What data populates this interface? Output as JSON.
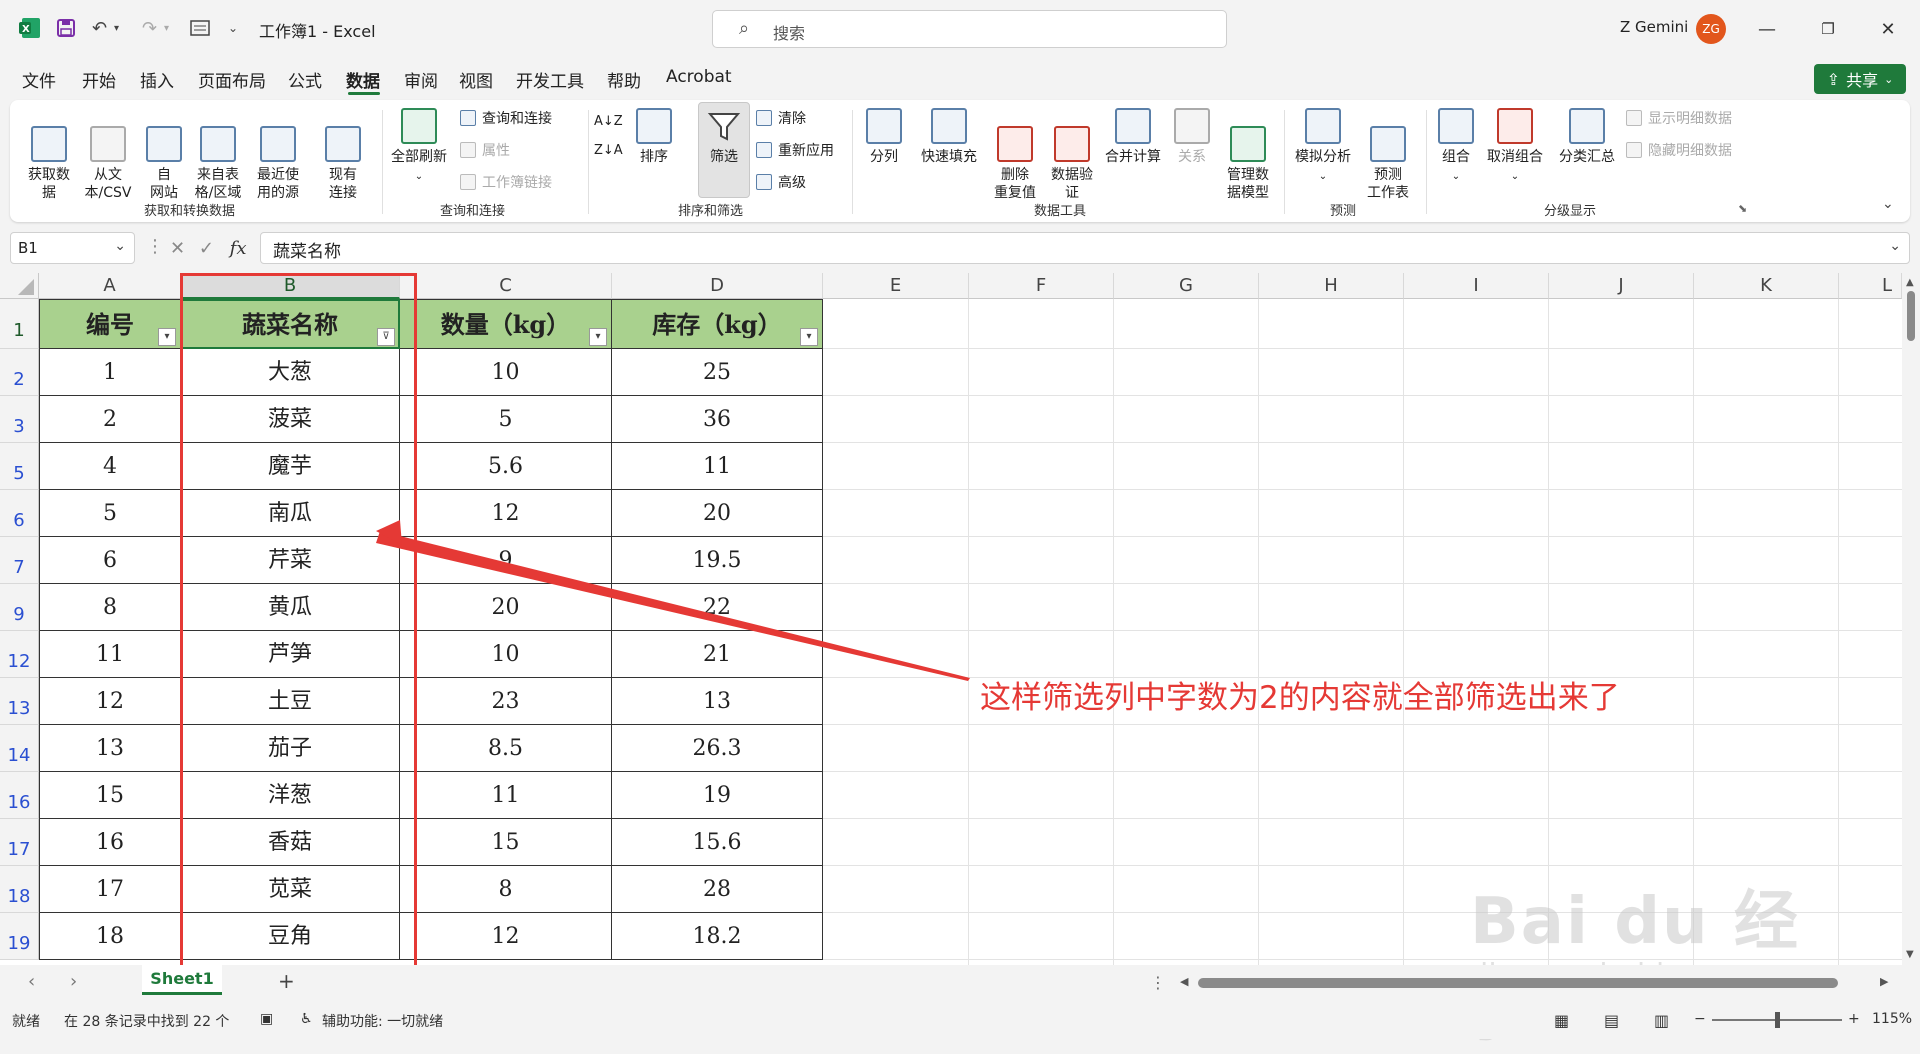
{
  "titlebar": {
    "title": "工作簿1 - Excel",
    "search_placeholder": "搜索",
    "user_name": "Z Gemini",
    "avatar_initials": "ZG"
  },
  "menu": {
    "tabs": [
      "文件",
      "开始",
      "插入",
      "页面布局",
      "公式",
      "数据",
      "审阅",
      "视图",
      "开发工具",
      "帮助",
      "Acrobat"
    ],
    "active_tab": "数据",
    "share_label": "共享"
  },
  "ribbon": {
    "get_data": "获取数\n据",
    "from_text_csv": "从文\n本/CSV",
    "from_web": "自\n网站",
    "from_table": "来自表\n格/区域",
    "recent_sources": "最近使\n用的源",
    "existing_connections": "现有\n连接",
    "group_get_transform": "获取和转换数据",
    "refresh_all": "全部刷新",
    "queries_connections": "查询和连接",
    "properties": "属性",
    "workbook_links": "工作簿链接",
    "group_queries": "查询和连接",
    "sort": "排序",
    "filter": "筛选",
    "clear": "清除",
    "reapply": "重新应用",
    "advanced": "高级",
    "group_sort_filter": "排序和筛选",
    "text_to_columns": "分列",
    "flash_fill": "快速填充",
    "remove_duplicates": "删除\n重复值",
    "data_validation": "数据验\n证",
    "consolidate": "合并计算",
    "relationships": "关系",
    "data_model": "管理数\n据模型",
    "group_data_tools": "数据工具",
    "what_if": "模拟分析",
    "forecast_sheet": "预测\n工作表",
    "group_forecast": "预测",
    "group_btn": "组合",
    "ungroup": "取消组合",
    "subtotal": "分类汇总",
    "show_detail": "显示明细数据",
    "hide_detail": "隐藏明细数据",
    "group_outline": "分级显示"
  },
  "formula_bar": {
    "name_box": "B1",
    "formula": "蔬菜名称",
    "fx": "fx"
  },
  "grid": {
    "columns": [
      "A",
      "B",
      "C",
      "D",
      "E",
      "F",
      "G",
      "H",
      "I",
      "J",
      "K",
      "L"
    ],
    "headers": [
      "编号",
      "蔬菜名称",
      "数量（kg）",
      "库存（kg）"
    ],
    "rows": [
      {
        "row_num": "1",
        "cells": [
          "编号",
          "蔬菜名称",
          "数量（kg）",
          "库存（kg）"
        ]
      },
      {
        "row_num": "2",
        "cells": [
          "1",
          "大葱",
          "10",
          "25"
        ]
      },
      {
        "row_num": "3",
        "cells": [
          "2",
          "菠菜",
          "5",
          "36"
        ]
      },
      {
        "row_num": "5",
        "cells": [
          "4",
          "魔芋",
          "5.6",
          "11"
        ]
      },
      {
        "row_num": "6",
        "cells": [
          "5",
          "南瓜",
          "12",
          "20"
        ]
      },
      {
        "row_num": "7",
        "cells": [
          "6",
          "芹菜",
          "9",
          "19.5"
        ]
      },
      {
        "row_num": "9",
        "cells": [
          "8",
          "黄瓜",
          "20",
          "22"
        ]
      },
      {
        "row_num": "12",
        "cells": [
          "11",
          "芦笋",
          "10",
          "21"
        ]
      },
      {
        "row_num": "13",
        "cells": [
          "12",
          "土豆",
          "23",
          "13"
        ]
      },
      {
        "row_num": "14",
        "cells": [
          "13",
          "茄子",
          "8.5",
          "26.3"
        ]
      },
      {
        "row_num": "16",
        "cells": [
          "15",
          "洋葱",
          "11",
          "19"
        ]
      },
      {
        "row_num": "17",
        "cells": [
          "16",
          "香菇",
          "15",
          "15.6"
        ]
      },
      {
        "row_num": "18",
        "cells": [
          "17",
          "苋菜",
          "8",
          "28"
        ]
      },
      {
        "row_num": "19",
        "cells": [
          "18",
          "豆角",
          "12",
          "18.2"
        ]
      }
    ]
  },
  "annotation": {
    "text": "这样筛选列中字数为2的内容就全部筛选出来了",
    "color": "#e53935"
  },
  "sheets": {
    "tabs": [
      "Sheet1"
    ],
    "add": "+"
  },
  "status": {
    "ready": "就绪",
    "filter_result": "在 28 条记录中找到 22 个",
    "accessibility": "辅助功能: 一切就绪",
    "zoom": "115%"
  },
  "watermark": {
    "main": "Bai du 经验",
    "sub": "jingyan.baidu.com"
  },
  "colors": {
    "excel_green": "#1f7a3b",
    "header_fill": "#a9d18e",
    "annotation_red": "#e53935"
  }
}
